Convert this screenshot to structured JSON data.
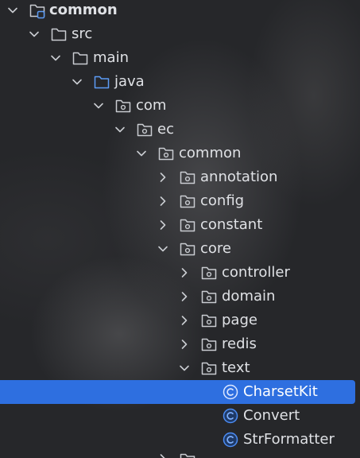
{
  "project_tree": {
    "items": [
      {
        "label": "common",
        "kind": "module",
        "state": "expanded",
        "bold": true
      },
      {
        "label": "src",
        "kind": "folder",
        "state": "expanded"
      },
      {
        "label": "main",
        "kind": "folder",
        "state": "expanded"
      },
      {
        "label": "java",
        "kind": "source-root",
        "state": "expanded"
      },
      {
        "label": "com",
        "kind": "package",
        "state": "expanded"
      },
      {
        "label": "ec",
        "kind": "package",
        "state": "expanded"
      },
      {
        "label": "common",
        "kind": "package",
        "state": "expanded"
      },
      {
        "label": "annotation",
        "kind": "package",
        "state": "collapsed"
      },
      {
        "label": "config",
        "kind": "package",
        "state": "collapsed"
      },
      {
        "label": "constant",
        "kind": "package",
        "state": "collapsed"
      },
      {
        "label": "core",
        "kind": "package",
        "state": "expanded"
      },
      {
        "label": "controller",
        "kind": "package",
        "state": "collapsed"
      },
      {
        "label": "domain",
        "kind": "package",
        "state": "collapsed"
      },
      {
        "label": "page",
        "kind": "package",
        "state": "collapsed"
      },
      {
        "label": "redis",
        "kind": "package",
        "state": "collapsed"
      },
      {
        "label": "text",
        "kind": "package",
        "state": "expanded"
      },
      {
        "label": "CharsetKit",
        "kind": "class",
        "state": "leaf",
        "selected": true
      },
      {
        "label": "Convert",
        "kind": "class",
        "state": "leaf"
      },
      {
        "label": "StrFormatter",
        "kind": "class",
        "state": "leaf"
      }
    ]
  },
  "colors": {
    "background": "#26272a",
    "selection": "#2e6fe0",
    "text": "#dfe1e5",
    "source_root_folder": "#5c9cf5",
    "class_icon": "#4b8cf5"
  }
}
